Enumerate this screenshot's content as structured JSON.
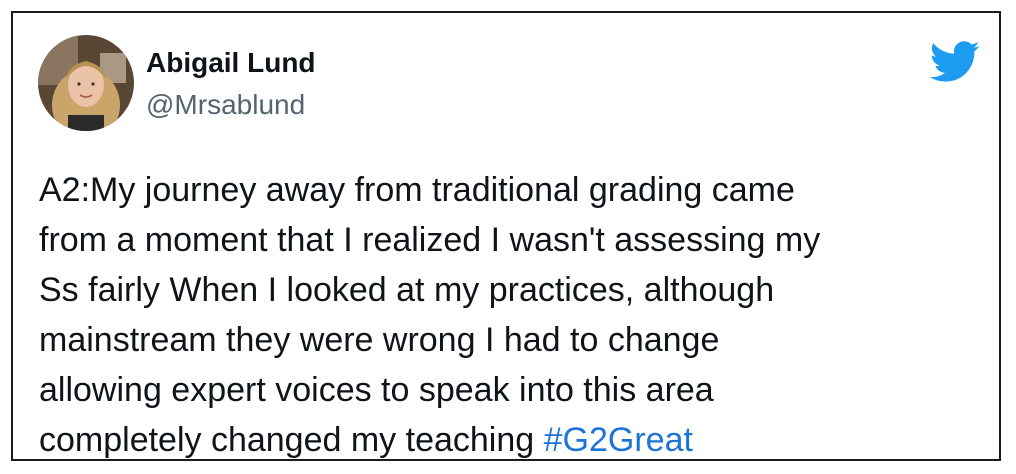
{
  "tweet": {
    "author_name": "Abigail Lund",
    "author_handle": "@Mrsablund",
    "lines": [
      "A2:My journey away from traditional grading came",
      "from a moment that I realized I wasn't assessing my",
      "Ss fairly When I looked at my practices, although",
      "mainstream they were wrong I had to change",
      "allowing expert voices to speak into this area",
      "completely changed my teaching "
    ],
    "hashtag": "#G2Great"
  },
  "icons": {
    "brand": "twitter-bird-icon",
    "avatar": "profile-photo"
  },
  "colors": {
    "hashtag": "#1b74d6",
    "twitter_blue": "#1d9bf0",
    "text": "#0f1419",
    "secondary_text": "#536471",
    "border": "#1c1c1c"
  }
}
